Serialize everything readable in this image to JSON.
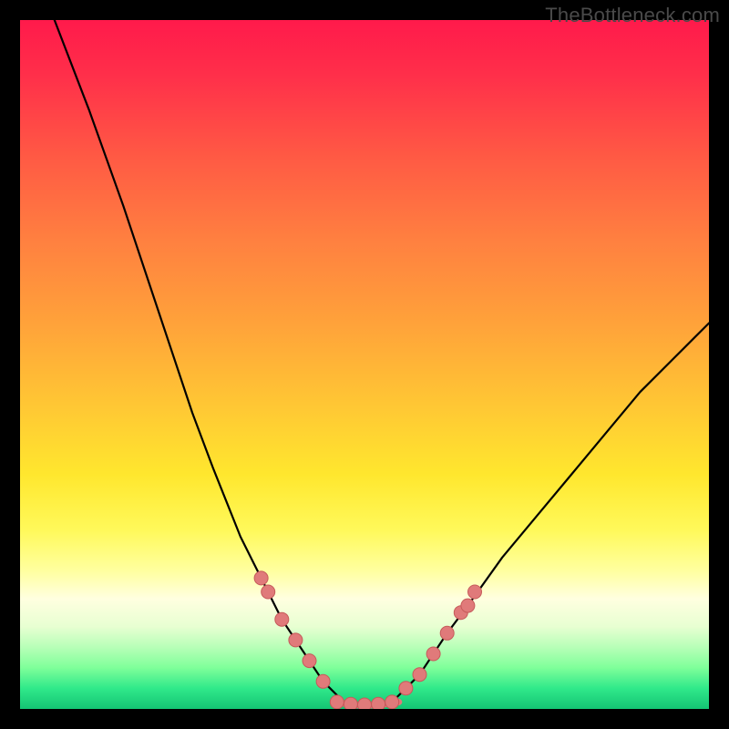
{
  "watermark": "TheBottleneck.com",
  "chart_data": {
    "type": "line",
    "title": "",
    "xlabel": "",
    "ylabel": "",
    "xlim": [
      0,
      100
    ],
    "ylim": [
      0,
      100
    ],
    "series": [
      {
        "name": "left-curve",
        "x": [
          5,
          10,
          15,
          20,
          25,
          28,
          30,
          32,
          34,
          36,
          38,
          40,
          42,
          44,
          45,
          46,
          47
        ],
        "y": [
          100,
          87,
          73,
          58,
          43,
          35,
          30,
          25,
          21,
          17,
          13,
          10,
          7,
          4,
          3,
          2,
          1
        ]
      },
      {
        "name": "right-curve",
        "x": [
          54,
          55,
          56,
          58,
          60,
          62,
          65,
          70,
          75,
          80,
          85,
          90,
          95,
          100
        ],
        "y": [
          1,
          2,
          3,
          5,
          8,
          11,
          15,
          22,
          28,
          34,
          40,
          46,
          51,
          56
        ]
      },
      {
        "name": "valley-floor",
        "x": [
          46,
          48,
          50,
          52,
          54,
          55
        ],
        "y": [
          1,
          0.6,
          0.5,
          0.6,
          0.8,
          1
        ]
      }
    ],
    "markers": [
      {
        "series": "left-curve",
        "x": 35,
        "y": 19
      },
      {
        "series": "left-curve",
        "x": 36,
        "y": 17
      },
      {
        "series": "left-curve",
        "x": 38,
        "y": 13
      },
      {
        "series": "left-curve",
        "x": 40,
        "y": 10
      },
      {
        "series": "left-curve",
        "x": 42,
        "y": 7
      },
      {
        "series": "left-curve",
        "x": 44,
        "y": 4
      },
      {
        "series": "valley-floor",
        "x": 46,
        "y": 1
      },
      {
        "series": "valley-floor",
        "x": 48,
        "y": 0.7
      },
      {
        "series": "valley-floor",
        "x": 50,
        "y": 0.6
      },
      {
        "series": "valley-floor",
        "x": 52,
        "y": 0.7
      },
      {
        "series": "valley-floor",
        "x": 54,
        "y": 1
      },
      {
        "series": "right-curve",
        "x": 56,
        "y": 3
      },
      {
        "series": "right-curve",
        "x": 58,
        "y": 5
      },
      {
        "series": "right-curve",
        "x": 60,
        "y": 8
      },
      {
        "series": "right-curve",
        "x": 62,
        "y": 11
      },
      {
        "series": "right-curve",
        "x": 64,
        "y": 14
      },
      {
        "series": "right-curve",
        "x": 65,
        "y": 15
      },
      {
        "series": "right-curve",
        "x": 66,
        "y": 17
      }
    ],
    "colors": {
      "curve_stroke": "#000000",
      "marker_fill": "#e07a7a",
      "marker_stroke": "#c65a5a"
    }
  }
}
